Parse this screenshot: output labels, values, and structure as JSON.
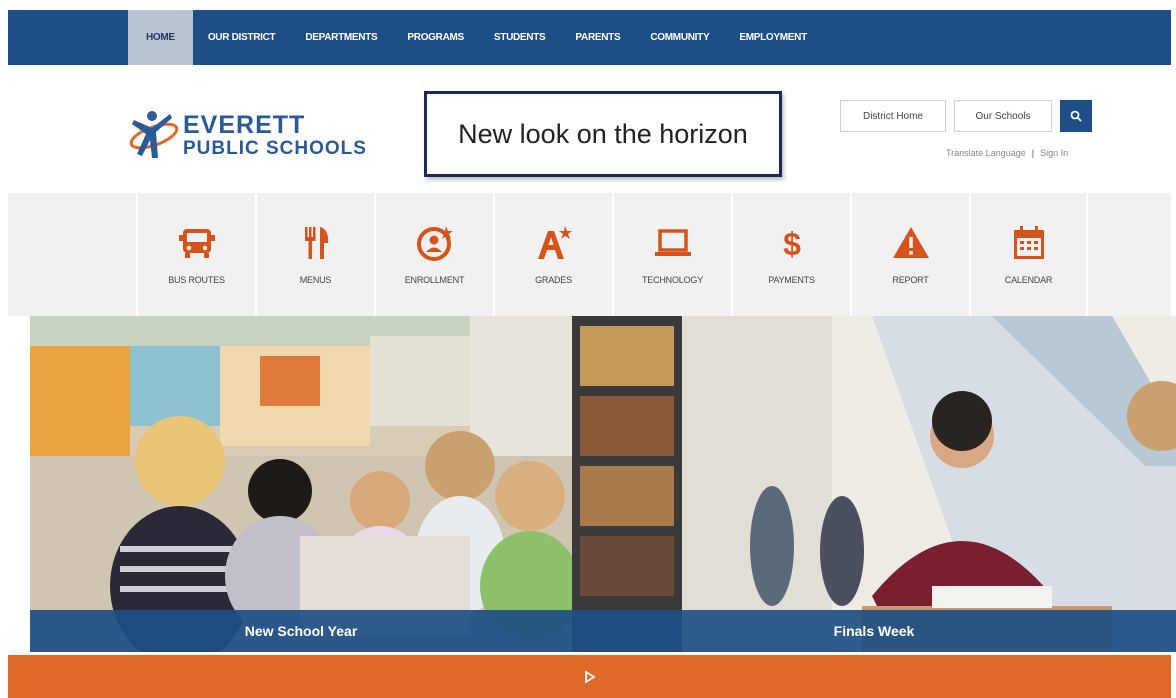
{
  "nav": {
    "items": [
      {
        "label": "HOME",
        "active": true
      },
      {
        "label": "OUR DISTRICT"
      },
      {
        "label": "DEPARTMENTS"
      },
      {
        "label": "PROGRAMS"
      },
      {
        "label": "STUDENTS"
      },
      {
        "label": "PARENTS"
      },
      {
        "label": "COMMUNITY"
      },
      {
        "label": "EMPLOYMENT"
      }
    ]
  },
  "header": {
    "logo_line1": "EVERETT",
    "logo_line2": "PUBLIC SCHOOLS",
    "announcement": "New look on the horizon",
    "district_home": "District Home",
    "our_schools": "Our Schools",
    "translate": "Translate Language",
    "separator": "|",
    "sign_in": "Sign In"
  },
  "quick_links": [
    {
      "label": "BUS ROUTES",
      "icon": "bus-icon"
    },
    {
      "label": "MENUS",
      "icon": "fork-knife-icon"
    },
    {
      "label": "ENROLLMENT",
      "icon": "enrollment-icon"
    },
    {
      "label": "GRADES",
      "icon": "grades-icon"
    },
    {
      "label": "TECHNOLOGY",
      "icon": "laptop-icon"
    },
    {
      "label": "PAYMENTS",
      "icon": "dollar-icon"
    },
    {
      "label": "REPORT",
      "icon": "warning-icon"
    },
    {
      "label": "CALENDAR",
      "icon": "calendar-icon"
    }
  ],
  "hero": {
    "slides": [
      {
        "caption": "New School Year"
      },
      {
        "caption": "Finals Week"
      }
    ]
  },
  "colors": {
    "nav_blue": "#1e4e86",
    "accent_orange": "#e06a2b",
    "icon_orange": "#d4541c"
  }
}
